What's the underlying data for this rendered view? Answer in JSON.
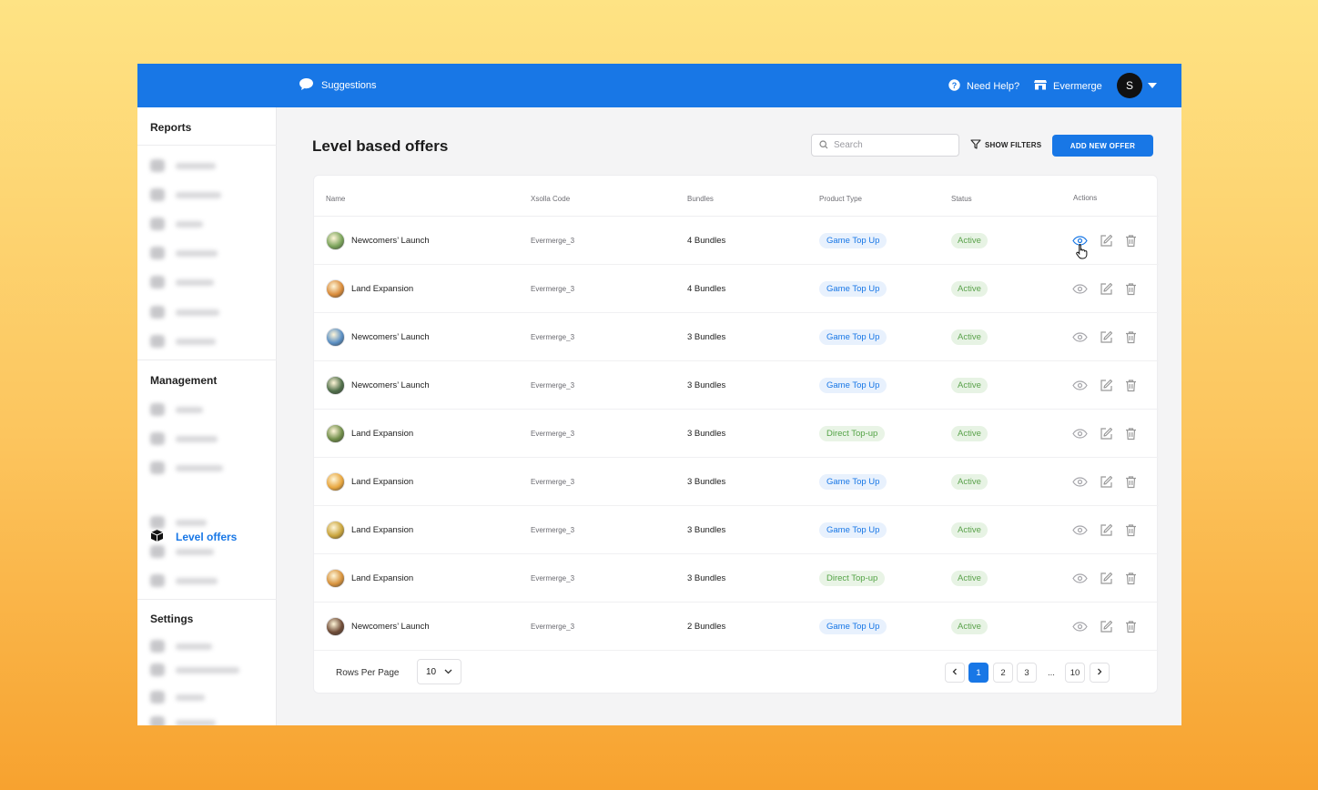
{
  "topbar": {
    "suggestions_label": "Suggestions",
    "help_label": "Need Help?",
    "store_label": "Evermerge",
    "avatar_initial": "S"
  },
  "sidebar": {
    "reports_title": "Reports",
    "management_title": "Management",
    "active_item_label": "Level offers",
    "settings_title": "Settings"
  },
  "header": {
    "title": "Level based offers",
    "search_placeholder": "Search",
    "show_filters_label": "SHOW FILTERS",
    "add_offer_label": "ADD NEW OFFER"
  },
  "table": {
    "columns": [
      "Name",
      "Xsolla Code",
      "Bundles",
      "Product Type",
      "Status",
      "Actions"
    ],
    "rows": [
      {
        "name": "Newcomers’ Launch",
        "code": "Evermerge_3",
        "bundles": "4 Bundles",
        "type": "Game Top Up",
        "status": "Active",
        "thumb_color": "#7aa35a"
      },
      {
        "name": "Land Expansion",
        "code": "Evermerge_3",
        "bundles": "4 Bundles",
        "type": "Game Top Up",
        "status": "Active",
        "thumb_color": "#d98b3a"
      },
      {
        "name": "Newcomers’ Launch",
        "code": "Evermerge_3",
        "bundles": "3 Bundles",
        "type": "Game Top Up",
        "status": "Active",
        "thumb_color": "#5a8fc4"
      },
      {
        "name": "Newcomers’ Launch",
        "code": "Evermerge_3",
        "bundles": "3 Bundles",
        "type": "Game Top Up",
        "status": "Active",
        "thumb_color": "#4f6e49"
      },
      {
        "name": "Land Expansion",
        "code": "Evermerge_3",
        "bundles": "3 Bundles",
        "type": "Direct Top-up",
        "status": "Active",
        "thumb_color": "#6f8c48"
      },
      {
        "name": "Land Expansion",
        "code": "Evermerge_3",
        "bundles": "3 Bundles",
        "type": "Game Top Up",
        "status": "Active",
        "thumb_color": "#e8a63e"
      },
      {
        "name": "Land Expansion",
        "code": "Evermerge_3",
        "bundles": "3 Bundles",
        "type": "Game Top Up",
        "status": "Active",
        "thumb_color": "#c9a43c"
      },
      {
        "name": "Land Expansion",
        "code": "Evermerge_3",
        "bundles": "3 Bundles",
        "type": "Direct Top-up",
        "status": "Active",
        "thumb_color": "#d7923c"
      },
      {
        "name": "Newcomers’ Launch",
        "code": "Evermerge_3",
        "bundles": "2 Bundles",
        "type": "Game Top Up",
        "status": "Active",
        "thumb_color": "#6e4a36"
      }
    ]
  },
  "footer": {
    "rows_per_page_label": "Rows Per Page",
    "rows_per_page_value": "10",
    "pages": [
      "1",
      "2",
      "3",
      "...",
      "10"
    ],
    "current_page": "1"
  },
  "colors": {
    "accent": "#1877e6",
    "status_active": "#5ba24c"
  }
}
